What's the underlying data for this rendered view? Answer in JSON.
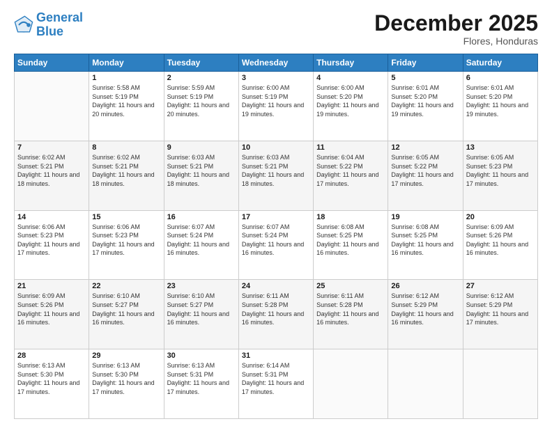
{
  "logo": {
    "line1": "General",
    "line2": "Blue"
  },
  "title": "December 2025",
  "subtitle": "Flores, Honduras",
  "header_days": [
    "Sunday",
    "Monday",
    "Tuesday",
    "Wednesday",
    "Thursday",
    "Friday",
    "Saturday"
  ],
  "weeks": [
    [
      {
        "day": "",
        "sunrise": "",
        "sunset": "",
        "daylight": ""
      },
      {
        "day": "1",
        "sunrise": "Sunrise: 5:58 AM",
        "sunset": "Sunset: 5:19 PM",
        "daylight": "Daylight: 11 hours and 20 minutes."
      },
      {
        "day": "2",
        "sunrise": "Sunrise: 5:59 AM",
        "sunset": "Sunset: 5:19 PM",
        "daylight": "Daylight: 11 hours and 20 minutes."
      },
      {
        "day": "3",
        "sunrise": "Sunrise: 6:00 AM",
        "sunset": "Sunset: 5:19 PM",
        "daylight": "Daylight: 11 hours and 19 minutes."
      },
      {
        "day": "4",
        "sunrise": "Sunrise: 6:00 AM",
        "sunset": "Sunset: 5:20 PM",
        "daylight": "Daylight: 11 hours and 19 minutes."
      },
      {
        "day": "5",
        "sunrise": "Sunrise: 6:01 AM",
        "sunset": "Sunset: 5:20 PM",
        "daylight": "Daylight: 11 hours and 19 minutes."
      },
      {
        "day": "6",
        "sunrise": "Sunrise: 6:01 AM",
        "sunset": "Sunset: 5:20 PM",
        "daylight": "Daylight: 11 hours and 19 minutes."
      }
    ],
    [
      {
        "day": "7",
        "sunrise": "Sunrise: 6:02 AM",
        "sunset": "Sunset: 5:21 PM",
        "daylight": "Daylight: 11 hours and 18 minutes."
      },
      {
        "day": "8",
        "sunrise": "Sunrise: 6:02 AM",
        "sunset": "Sunset: 5:21 PM",
        "daylight": "Daylight: 11 hours and 18 minutes."
      },
      {
        "day": "9",
        "sunrise": "Sunrise: 6:03 AM",
        "sunset": "Sunset: 5:21 PM",
        "daylight": "Daylight: 11 hours and 18 minutes."
      },
      {
        "day": "10",
        "sunrise": "Sunrise: 6:03 AM",
        "sunset": "Sunset: 5:21 PM",
        "daylight": "Daylight: 11 hours and 18 minutes."
      },
      {
        "day": "11",
        "sunrise": "Sunrise: 6:04 AM",
        "sunset": "Sunset: 5:22 PM",
        "daylight": "Daylight: 11 hours and 17 minutes."
      },
      {
        "day": "12",
        "sunrise": "Sunrise: 6:05 AM",
        "sunset": "Sunset: 5:22 PM",
        "daylight": "Daylight: 11 hours and 17 minutes."
      },
      {
        "day": "13",
        "sunrise": "Sunrise: 6:05 AM",
        "sunset": "Sunset: 5:23 PM",
        "daylight": "Daylight: 11 hours and 17 minutes."
      }
    ],
    [
      {
        "day": "14",
        "sunrise": "Sunrise: 6:06 AM",
        "sunset": "Sunset: 5:23 PM",
        "daylight": "Daylight: 11 hours and 17 minutes."
      },
      {
        "day": "15",
        "sunrise": "Sunrise: 6:06 AM",
        "sunset": "Sunset: 5:23 PM",
        "daylight": "Daylight: 11 hours and 17 minutes."
      },
      {
        "day": "16",
        "sunrise": "Sunrise: 6:07 AM",
        "sunset": "Sunset: 5:24 PM",
        "daylight": "Daylight: 11 hours and 16 minutes."
      },
      {
        "day": "17",
        "sunrise": "Sunrise: 6:07 AM",
        "sunset": "Sunset: 5:24 PM",
        "daylight": "Daylight: 11 hours and 16 minutes."
      },
      {
        "day": "18",
        "sunrise": "Sunrise: 6:08 AM",
        "sunset": "Sunset: 5:25 PM",
        "daylight": "Daylight: 11 hours and 16 minutes."
      },
      {
        "day": "19",
        "sunrise": "Sunrise: 6:08 AM",
        "sunset": "Sunset: 5:25 PM",
        "daylight": "Daylight: 11 hours and 16 minutes."
      },
      {
        "day": "20",
        "sunrise": "Sunrise: 6:09 AM",
        "sunset": "Sunset: 5:26 PM",
        "daylight": "Daylight: 11 hours and 16 minutes."
      }
    ],
    [
      {
        "day": "21",
        "sunrise": "Sunrise: 6:09 AM",
        "sunset": "Sunset: 5:26 PM",
        "daylight": "Daylight: 11 hours and 16 minutes."
      },
      {
        "day": "22",
        "sunrise": "Sunrise: 6:10 AM",
        "sunset": "Sunset: 5:27 PM",
        "daylight": "Daylight: 11 hours and 16 minutes."
      },
      {
        "day": "23",
        "sunrise": "Sunrise: 6:10 AM",
        "sunset": "Sunset: 5:27 PM",
        "daylight": "Daylight: 11 hours and 16 minutes."
      },
      {
        "day": "24",
        "sunrise": "Sunrise: 6:11 AM",
        "sunset": "Sunset: 5:28 PM",
        "daylight": "Daylight: 11 hours and 16 minutes."
      },
      {
        "day": "25",
        "sunrise": "Sunrise: 6:11 AM",
        "sunset": "Sunset: 5:28 PM",
        "daylight": "Daylight: 11 hours and 16 minutes."
      },
      {
        "day": "26",
        "sunrise": "Sunrise: 6:12 AM",
        "sunset": "Sunset: 5:29 PM",
        "daylight": "Daylight: 11 hours and 16 minutes."
      },
      {
        "day": "27",
        "sunrise": "Sunrise: 6:12 AM",
        "sunset": "Sunset: 5:29 PM",
        "daylight": "Daylight: 11 hours and 17 minutes."
      }
    ],
    [
      {
        "day": "28",
        "sunrise": "Sunrise: 6:13 AM",
        "sunset": "Sunset: 5:30 PM",
        "daylight": "Daylight: 11 hours and 17 minutes."
      },
      {
        "day": "29",
        "sunrise": "Sunrise: 6:13 AM",
        "sunset": "Sunset: 5:30 PM",
        "daylight": "Daylight: 11 hours and 17 minutes."
      },
      {
        "day": "30",
        "sunrise": "Sunrise: 6:13 AM",
        "sunset": "Sunset: 5:31 PM",
        "daylight": "Daylight: 11 hours and 17 minutes."
      },
      {
        "day": "31",
        "sunrise": "Sunrise: 6:14 AM",
        "sunset": "Sunset: 5:31 PM",
        "daylight": "Daylight: 11 hours and 17 minutes."
      },
      {
        "day": "",
        "sunrise": "",
        "sunset": "",
        "daylight": ""
      },
      {
        "day": "",
        "sunrise": "",
        "sunset": "",
        "daylight": ""
      },
      {
        "day": "",
        "sunrise": "",
        "sunset": "",
        "daylight": ""
      }
    ]
  ]
}
